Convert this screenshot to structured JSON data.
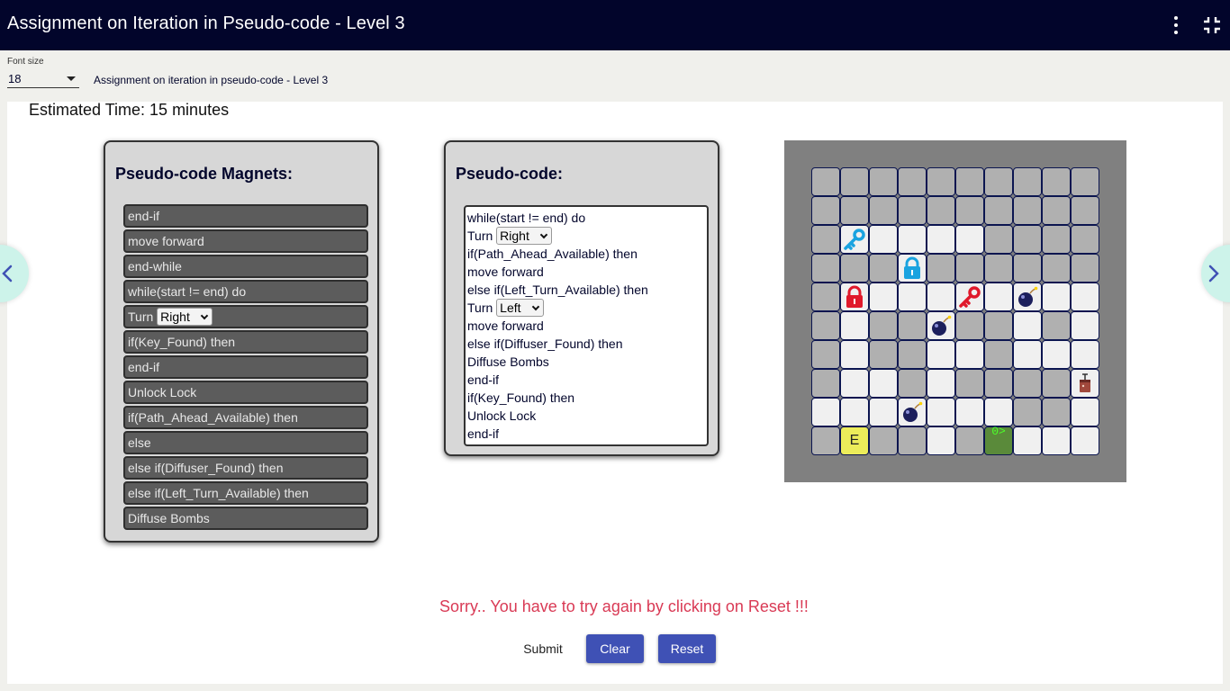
{
  "header": {
    "title": "Assignment on Iteration in Pseudo-code - Level 3",
    "menu_icon": "more-vert-icon",
    "collapse_icon": "fullscreen-exit-icon"
  },
  "toolbar": {
    "font_size_label": "Font size",
    "font_size_value": "18",
    "assignment_name": "Assignment on iteration in pseudo-code - Level 3"
  },
  "main": {
    "estimated_time": "Estimated Time: 15 minutes",
    "magnets_title": "Pseudo-code Magnets:",
    "magnets": [
      {
        "text": "end-if"
      },
      {
        "text": "move forward"
      },
      {
        "text": "end-while"
      },
      {
        "text": "while(start != end) do"
      },
      {
        "text": "Turn",
        "select": "Right"
      },
      {
        "text": "if(Key_Found) then"
      },
      {
        "text": "end-if"
      },
      {
        "text": "Unlock Lock"
      },
      {
        "text": "if(Path_Ahead_Available) then"
      },
      {
        "text": "else"
      },
      {
        "text": "else if(Diffuser_Found) then"
      },
      {
        "text": "else if(Left_Turn_Available) then"
      },
      {
        "text": "Diffuse Bombs"
      }
    ],
    "code_title": "Pseudo-code:",
    "code_lines": [
      {
        "text": "while(start != end) do"
      },
      {
        "text": "Turn",
        "select": "Right"
      },
      {
        "text": "if(Path_Ahead_Available) then"
      },
      {
        "text": "move forward"
      },
      {
        "text": "else if(Left_Turn_Available) then"
      },
      {
        "text": "Turn",
        "select": "Left"
      },
      {
        "text": "move forward"
      },
      {
        "text": "else if(Diffuser_Found) then"
      },
      {
        "text": "Diffuse Bombs"
      },
      {
        "text": "end-if"
      },
      {
        "text": "if(Key_Found) then"
      },
      {
        "text": "Unlock Lock"
      },
      {
        "text": "end-if"
      }
    ],
    "maze": {
      "rows": [
        "wwwwwwwwww",
        "wwwwwwwwww",
        "wooooowwww",
        "wwwowwwwww",
        "wooooooooo",
        "wowwowwowo",
        "wowwoowooo",
        "woowowwwwo",
        "ooooooowwo",
        "wewwowpooo"
      ],
      "items": [
        {
          "row": 2,
          "col": 1,
          "icon": "blue-key-icon"
        },
        {
          "row": 3,
          "col": 3,
          "icon": "blue-lock-icon"
        },
        {
          "row": 4,
          "col": 1,
          "icon": "red-lock-icon"
        },
        {
          "row": 4,
          "col": 5,
          "icon": "red-key-icon"
        },
        {
          "row": 4,
          "col": 7,
          "icon": "bomb-icon"
        },
        {
          "row": 5,
          "col": 4,
          "icon": "bomb-icon"
        },
        {
          "row": 7,
          "col": 9,
          "icon": "diffuser-icon"
        },
        {
          "row": 8,
          "col": 3,
          "icon": "bomb-icon"
        }
      ],
      "exit_label": "E",
      "player_label": "0>"
    },
    "message": "Sorry.. You have to try again by clicking on Reset !!!",
    "buttons": {
      "submit": "Submit",
      "clear": "Clear",
      "reset": "Reset"
    },
    "nav": {
      "prev_icon": "chevron-left-icon",
      "next_icon": "chevron-right-icon"
    }
  },
  "colors": {
    "header_bg": "#02052b",
    "accent": "#3f51b5",
    "error": "#d93a55",
    "blue_item": "#1aa3e0",
    "red_item": "#e0192b",
    "bomb": "#1c1f5c"
  }
}
